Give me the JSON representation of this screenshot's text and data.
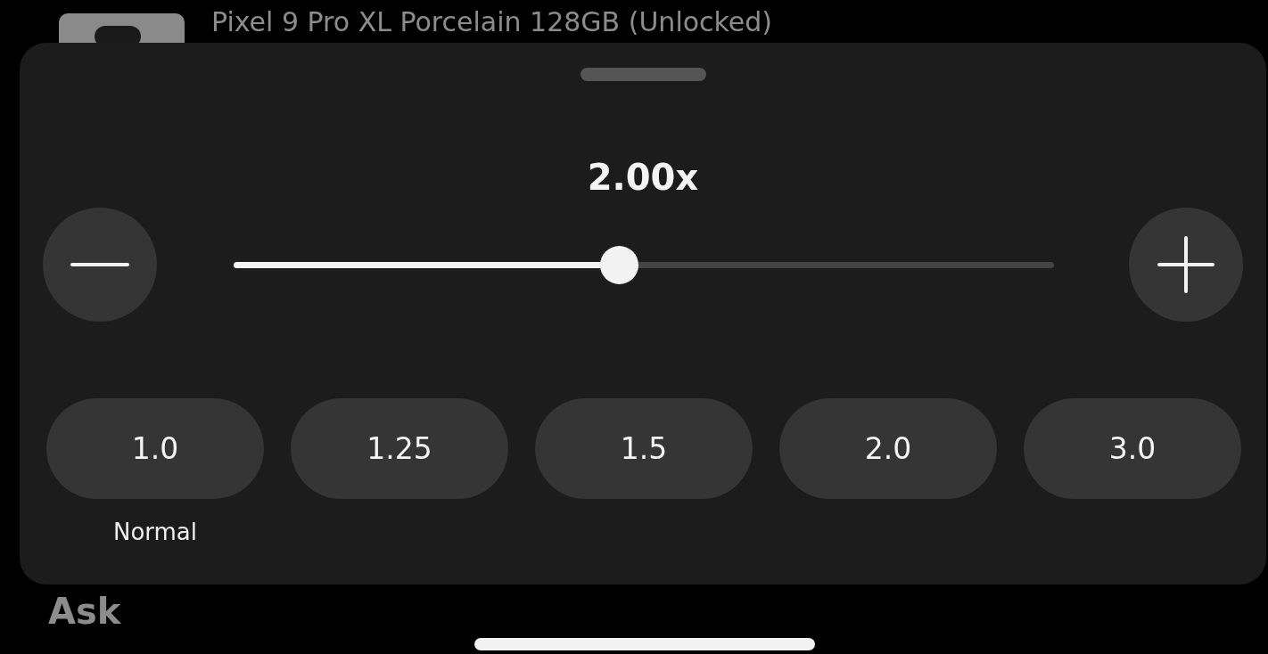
{
  "background": {
    "product_title": "Pixel 9 Pro XL Porcelain 128GB (Unlocked)",
    "section_heading": "Ask"
  },
  "speed_sheet": {
    "speed_value": "2.00x",
    "slider": {
      "level": 0.47
    },
    "presets": [
      {
        "label": "1.0",
        "caption": "Normal"
      },
      {
        "label": "1.25"
      },
      {
        "label": "1.5"
      },
      {
        "label": "2.0"
      },
      {
        "label": "3.0"
      }
    ]
  }
}
